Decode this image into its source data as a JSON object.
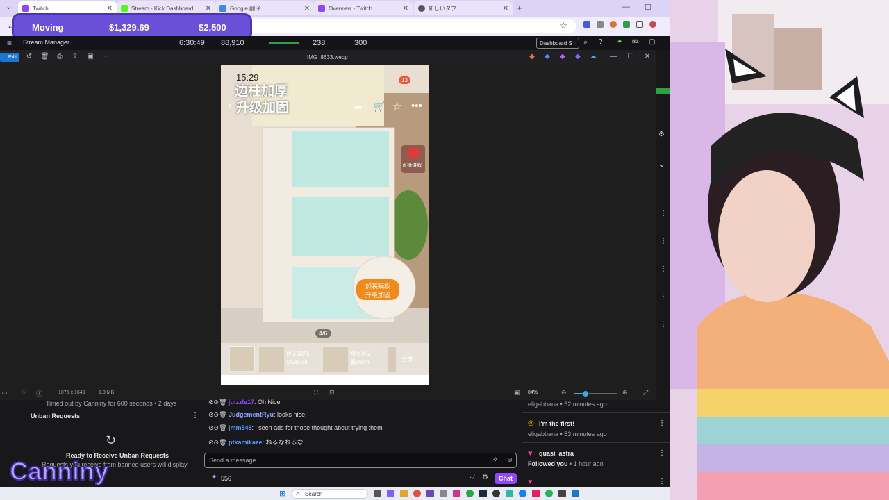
{
  "tabs": [
    {
      "label": "Twitch",
      "color": "#9146ff"
    },
    {
      "label": "Stream - Kick Dashboard",
      "color": "#53fc18"
    },
    {
      "label": "Google 翻译",
      "color": "#4285f4"
    },
    {
      "label": "Overview - Twitch",
      "color": "#9146ff"
    },
    {
      "label": "新しいタブ",
      "color": "#555"
    }
  ],
  "overlay": {
    "label": "Moving",
    "value1": "$1,329.69",
    "value2": "$2,500"
  },
  "stats": {
    "menu_label": "Stream Manager",
    "time": "6:30:49",
    "followers": "88,910",
    "viewers": "238",
    "subs": "300",
    "dashboard": "Dashboard S"
  },
  "viewer": {
    "edit_label": "Edit",
    "filename": "IMG_8633.webp",
    "dimensions": "1075 x 1649",
    "filesize": "1.3 MB",
    "zoom": "84%",
    "zoom_fraction": 0.28
  },
  "photo": {
    "time": "15:29",
    "headline_line1": "边柱加厚",
    "headline_line2": "升级加固",
    "badge_count": "13",
    "live_label": "直播讲解",
    "promo_line1": "加装隔板",
    "promo_line2": "升级加固",
    "page_indicator": "4/6",
    "thumb1_line1": "巨无霸PL",
    "thumb1_line2": "US85cm",
    "thumb2_line1": "特大巨无",
    "thumb2_line2": "霸80cm",
    "all_label": "全部"
  },
  "left_panel": {
    "timeout_text": "Timed out by Canniny for 600 seconds • 2 days",
    "section_title": "Unban Requests",
    "empty_title": "Ready to Receive Unban Requests",
    "empty_desc": "Requests you receive from banned users will display",
    "logo_text": "Canniny"
  },
  "chat": {
    "lines": [
      {
        "user": "juizzle17",
        "color": "#9146ff",
        "text": "Oh Nice"
      },
      {
        "user": "JudgementRyu",
        "color": "#8aa4ff",
        "text": "looks nice"
      },
      {
        "user": "jmm548",
        "color": "#5b9bff",
        "text": "i seen ads for those thought about trying them"
      },
      {
        "user": "ptkamikaze",
        "color": "#5b9bff",
        "text": "ねるなねるな"
      }
    ],
    "input_placeholder": "Send a message",
    "points": "556",
    "chat_button": "Chat"
  },
  "activity": {
    "items": [
      {
        "user": "eligabbana",
        "time": "52 minutes ago"
      },
      {
        "title": "I'm the first!",
        "user": "eligabbana",
        "time": "53 minutes ago"
      },
      {
        "title": "quasi_astra",
        "user": "Followed you",
        "time": "1 hour ago"
      }
    ],
    "sep": " • "
  },
  "taskbar": {
    "search": "Search"
  },
  "colors": {
    "twitch_purple": "#9146ff",
    "overlay_purple": "#6a4fd8"
  }
}
